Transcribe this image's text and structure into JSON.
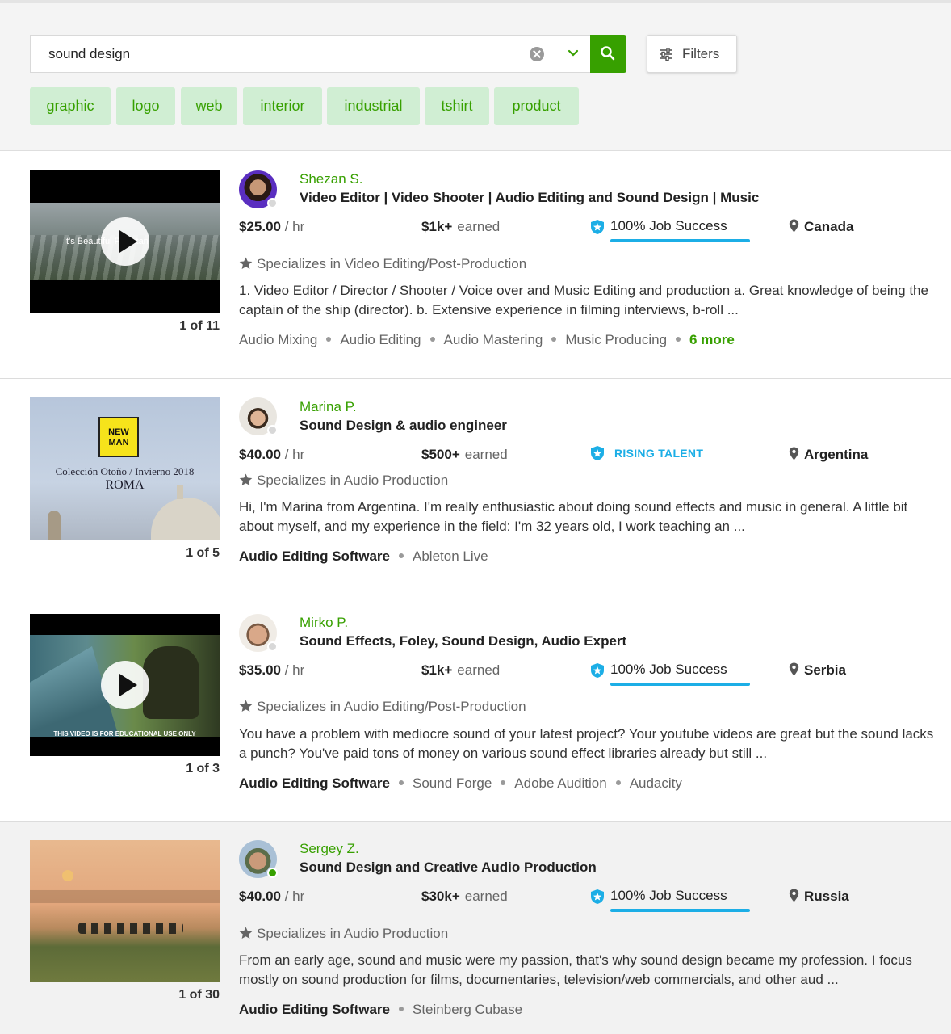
{
  "search": {
    "value": "sound design",
    "filters_label": "Filters"
  },
  "tags": [
    "graphic",
    "logo",
    "web",
    "interior",
    "industrial",
    "tshirt",
    "product"
  ],
  "freelancers": [
    {
      "counter": "1 of 11",
      "name": "Shezan S.",
      "title": "Video Editor | Video Shooter | Audio Editing and Sound Design | Music",
      "rate": "$25.00",
      "rate_unit": "/ hr",
      "earned": "$1k+",
      "earned_label": "earned",
      "badge": "100% Job Success",
      "country": "Canada",
      "specializes": "Specializes in Video Editing/Post-Production",
      "description": "1. Video Editor / Director / Shooter / Voice over and Music Editing and production a. Great knowledge of being the captain of the ship (director). b. Extensive experience in filming interviews, b-roll ...",
      "skills": [
        "Audio Mixing",
        "Audio Editing",
        "Audio Mastering",
        "Music Producing"
      ],
      "more": "6 more",
      "thumb_caption": "It's Beautiful Pakistan"
    },
    {
      "counter": "1 of 5",
      "name": "Marina P.",
      "title": "Sound Design & audio engineer",
      "rate": "$40.00",
      "rate_unit": "/ hr",
      "earned": "$500+",
      "earned_label": "earned",
      "badge": "RISING TALENT",
      "country": "Argentina",
      "specializes": "Specializes in Audio Production",
      "description": "Hi, I'm Marina from Argentina. I'm really enthusiastic about doing sound effects and music in general. A little bit about myself, and my experience in the field: I'm 32 years old, I work teaching an ...",
      "skills_heading": "Audio Editing Software",
      "skills": [
        "Ableton Live"
      ],
      "thumb_logo": "NEW MAN",
      "thumb_line1": "Colección Otoño / Invierno 2018",
      "thumb_line2": "ROMA"
    },
    {
      "counter": "1 of 3",
      "name": "Mirko P.",
      "title": "Sound Effects, Foley, Sound Design, Audio Expert",
      "rate": "$35.00",
      "rate_unit": "/ hr",
      "earned": "$1k+",
      "earned_label": "earned",
      "badge": "100% Job Success",
      "country": "Serbia",
      "specializes": "Specializes in Audio Editing/Post-Production",
      "description": "You have a problem with mediocre sound of your latest project? Your youtube videos are great but the sound lacks a punch? You've paid tons of money on various sound effect libraries already but still ...",
      "skills_heading": "Audio Editing Software",
      "skills": [
        "Sound Forge",
        "Adobe Audition",
        "Audacity"
      ],
      "thumb_caption": "THIS VIDEO IS FOR EDUCATIONAL USE ONLY"
    },
    {
      "counter": "1 of 30",
      "name": "Sergey Z.",
      "title": "Sound Design and Creative Audio Production",
      "rate": "$40.00",
      "rate_unit": "/ hr",
      "earned": "$30k+",
      "earned_label": "earned",
      "badge": "100% Job Success",
      "country": "Russia",
      "specializes": "Specializes in Audio Production",
      "description": "From an early age, sound and music were my passion, that's why sound design became my profession. I focus mostly on sound production for films, documentaries, television/web commercials, and other aud ...",
      "skills_heading": "Audio Editing Software",
      "skills": [
        "Steinberg Cubase"
      ]
    }
  ],
  "colors": {
    "brand_green": "#37a000",
    "tag_bg": "#d0eed3",
    "badge_blue": "#1caee6"
  }
}
